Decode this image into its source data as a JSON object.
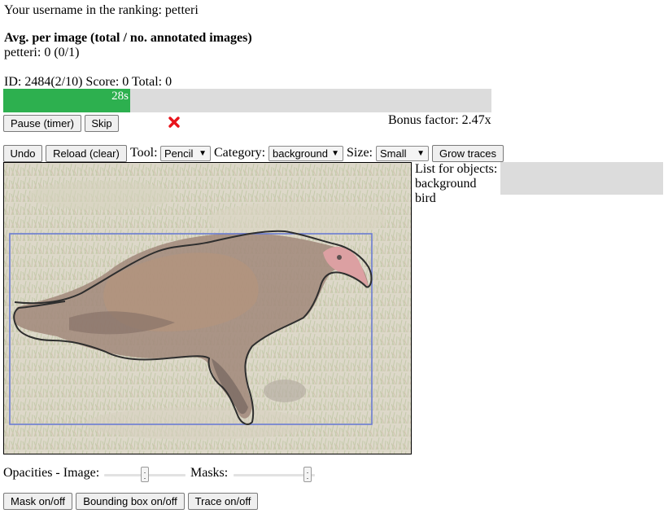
{
  "header": {
    "username_line": "Your username in the ranking: petteri",
    "avg_title": "Avg. per image (total / no. annotated images)",
    "avg_value": "petteri: 0 (0/1)",
    "id_line": "ID: 2484(2/10) Score: 0 Total: 0"
  },
  "timer": {
    "label": "28s",
    "progress": 0.26,
    "fill_color": "#2db04f",
    "track_color": "#dcdcdc"
  },
  "controls": {
    "pause_label": "Pause (timer)",
    "skip_label": "Skip",
    "status_icon": "red-x-icon",
    "bonus_text": "Bonus factor: 2.47x"
  },
  "toolbar": {
    "undo_label": "Undo",
    "reload_label": "Reload (clear)",
    "tool_label": "Tool:",
    "tool_value": "Pencil",
    "category_label": "Category:",
    "category_value": "background",
    "size_label": "Size:",
    "size_value": "Small",
    "grow_label": "Grow traces"
  },
  "objects": {
    "title": "List for objects:",
    "items": [
      "background",
      "bird"
    ]
  },
  "opacities": {
    "label": "Opacities - Image:",
    "masks_label": "Masks:",
    "image_level": 0.5,
    "masks_level": 0.95
  },
  "footer": {
    "mask_label": "Mask on/off",
    "bbox_label": "Bounding box on/off",
    "trace_label": "Trace on/off"
  },
  "colors": {
    "bbox": "#4a5fc9",
    "trace": "#000000",
    "status_icon": "#e8141c"
  }
}
